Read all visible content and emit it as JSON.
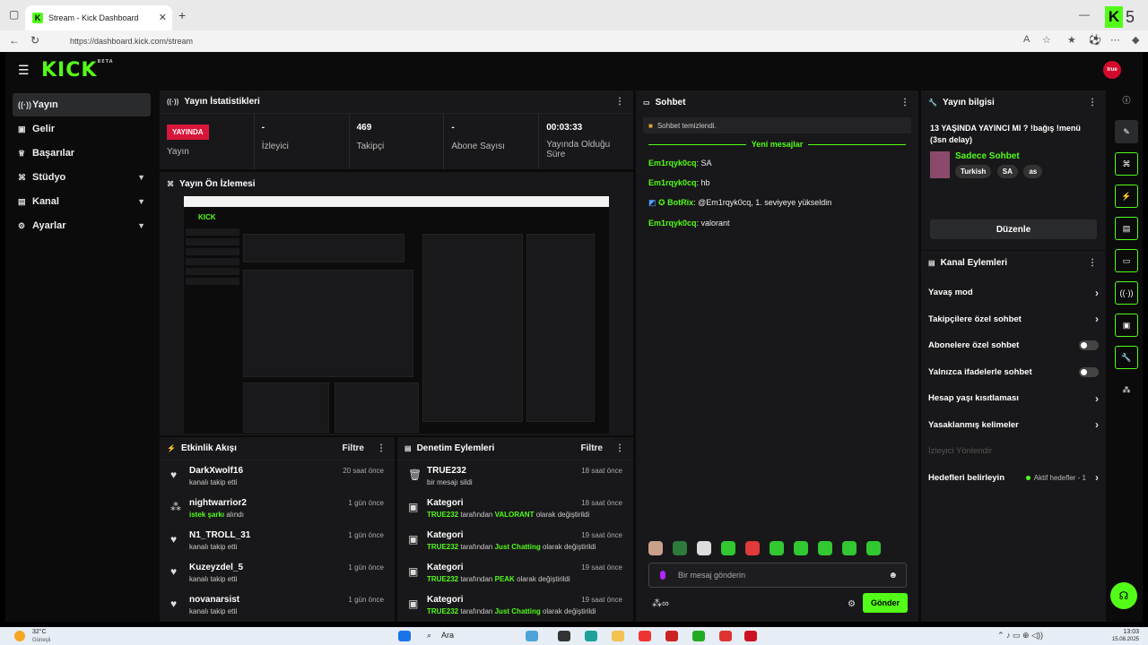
{
  "browser": {
    "tab_title": "Stream - Kick Dashboard",
    "url": "https://dashboard.kick.com/stream"
  },
  "app": {
    "logo": "KICK",
    "logo_badge": "BETA",
    "avatar_text": "true"
  },
  "sidebar": {
    "items": [
      {
        "label": "Yayın",
        "icon": "broadcast-icon"
      },
      {
        "label": "Gelir",
        "icon": "money-icon"
      },
      {
        "label": "Başarılar",
        "icon": "trophy-icon"
      },
      {
        "label": "Stüdyo",
        "icon": "studio-icon"
      },
      {
        "label": "Kanal",
        "icon": "channel-icon"
      },
      {
        "label": "Ayarlar",
        "icon": "gear-icon"
      }
    ]
  },
  "stats": {
    "title": "Yayın İstatistikleri",
    "live_badge": "YAYINDA",
    "items": [
      {
        "value": "",
        "label": "Yayın"
      },
      {
        "value": "-",
        "label": "İzleyici"
      },
      {
        "value": "469",
        "label": "Takipçi"
      },
      {
        "value": "-",
        "label": "Abone Sayısı"
      },
      {
        "value": "00:03:33",
        "label": "Yayında Olduğu Süre"
      }
    ]
  },
  "preview": {
    "title": "Yayın Ön İzlemesi"
  },
  "activity": {
    "title": "Etkinlik Akışı",
    "filter": "Filtre",
    "rows": [
      {
        "name": "DarkXwolf16",
        "sub": "kanalı takip etti",
        "time": "20 saat önce"
      },
      {
        "name": "nightwarrior2",
        "sub_hl": "istek şarkı",
        "sub_rest": " alındı",
        "time": "1 gün önce"
      },
      {
        "name": "N1_TROLL_31",
        "sub": "kanalı takip etti",
        "time": "1 gün önce"
      },
      {
        "name": "Kuzeyzdel_5",
        "sub": "kanalı takip etti",
        "time": "1 gün önce"
      },
      {
        "name": "novanarsist",
        "sub": "kanalı takip etti",
        "time": "1 gün önce"
      }
    ]
  },
  "moderation": {
    "title": "Denetim Eylemleri",
    "filter": "Filtre",
    "rows": [
      {
        "name": "TRUE232",
        "sub": "bir mesajı sildi",
        "time": "18 saat önce"
      },
      {
        "name": "Kategori",
        "user": "TRUE232",
        "mid": " tarafından ",
        "hl": "VALORANT",
        "end": " olarak değiştirildi",
        "time": "18 saat önce"
      },
      {
        "name": "Kategori",
        "user": "TRUE232",
        "mid": " tarafından ",
        "hl": "Just Chatting",
        "end": " olarak değiştirildi",
        "time": "19 saat önce"
      },
      {
        "name": "Kategori",
        "user": "TRUE232",
        "mid": " tarafından ",
        "hl": "PEAK",
        "end": " olarak değiştirildi",
        "time": "19 saat önce"
      },
      {
        "name": "Kategori",
        "user": "TRUE232",
        "mid": " tarafından ",
        "hl": "Just Chatting",
        "end": " olarak değiştirildi",
        "time": "19 saat önce"
      }
    ]
  },
  "chat": {
    "title": "Sohbet",
    "cleared": "Sohbet temizlendi.",
    "new_messages": "Yeni mesajlar",
    "messages": [
      {
        "user": "Em1rqyk0cq",
        "text": ": SA"
      },
      {
        "user": "Em1rqyk0cq",
        "text": ": hb"
      },
      {
        "user": "BotRix",
        "text": ": @Em1rqyk0cq, 1. seviyeye yükseldin"
      },
      {
        "user": "Em1rqyk0cq",
        "text": ": valorant"
      }
    ],
    "input_placeholder": "Bir mesaj gönderin",
    "send_label": "Gönder"
  },
  "stream_info": {
    "title": "Yayın bilgisi",
    "stream_title": "13 YAŞINDA YAYINCI MI ? !bağış !menü (3sn delay)",
    "category": "Sadece Sohbet",
    "tags": [
      "Turkish",
      "SA",
      "as"
    ],
    "edit_label": "Düzenle"
  },
  "channel_actions": {
    "title": "Kanal Eylemleri",
    "items": [
      {
        "label": "Yavaş mod",
        "type": "chevron"
      },
      {
        "label": "Takipçilere özel sohbet",
        "type": "chevron"
      },
      {
        "label": "Abonelere özel sohbet",
        "type": "toggle"
      },
      {
        "label": "Yalnızca ifadelerle sohbet",
        "type": "toggle"
      },
      {
        "label": "Hesap yaşı kısıtlaması",
        "type": "chevron"
      },
      {
        "label": "Yasaklanmış kelimeler",
        "type": "chevron"
      },
      {
        "label": "İzleyici Yönlendir",
        "type": "muted"
      },
      {
        "label": "Hedefleri belirleyin",
        "type": "goals",
        "extra": "Aktif hedefler - 1"
      }
    ]
  },
  "taskbar": {
    "weather_temp": "32°C",
    "weather_desc": "Güneşli",
    "search": "Ara",
    "time": "13:03",
    "date": "15.08.2025"
  }
}
